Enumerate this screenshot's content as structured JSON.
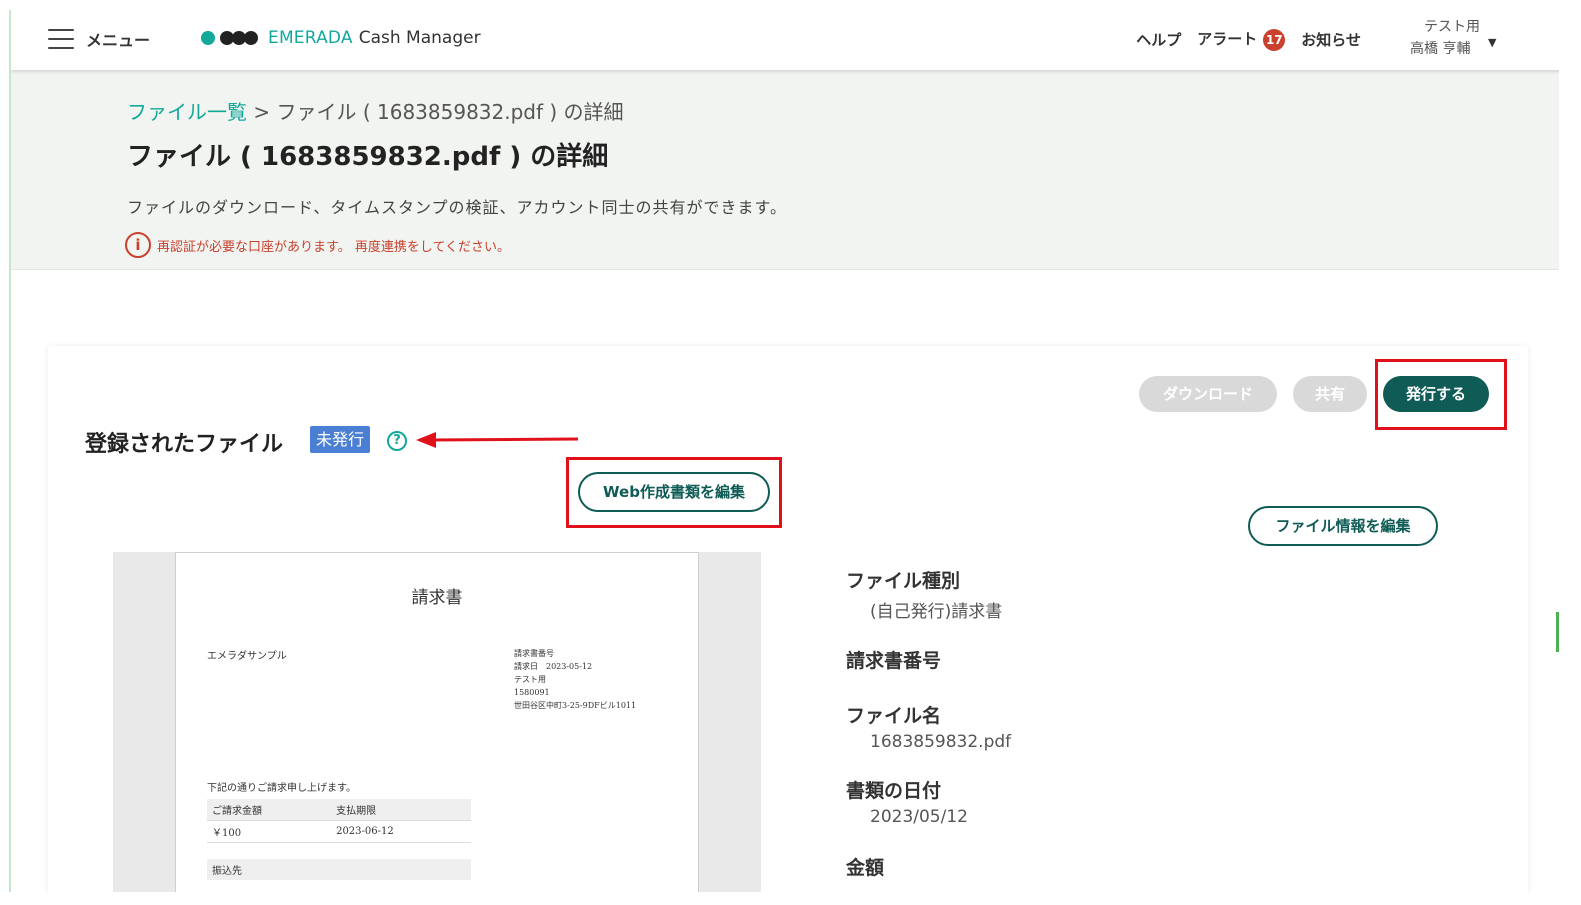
{
  "header": {
    "menu_label": "メニュー",
    "brand_name": "EMERADA",
    "brand_sub": "Cash Manager",
    "nav": {
      "help": "ヘルプ",
      "alert": "アラート",
      "alert_count": "17",
      "notice": "お知らせ"
    },
    "user": {
      "org": "テスト用",
      "name": "高橋 亨輔"
    }
  },
  "title_band": {
    "breadcrumb_link": "ファイル一覧",
    "breadcrumb_sep": " > ",
    "breadcrumb_current": "ファイル ( 1683859832.pdf ) の詳細",
    "page_title": "ファイル ( 1683859832.pdf ) の詳細",
    "description": "ファイルのダウンロード、タイムスタンプの検証、アカウント同士の共有ができます。",
    "warning": "再認証が必要な口座があります。 再度連携をしてください。"
  },
  "actions": {
    "download": "ダウンロード",
    "share": "共有",
    "issue": "発行する"
  },
  "file_section": {
    "title": "登録されたファイル",
    "status": "未発行",
    "help_glyph": "?",
    "web_edit": "Web作成書類を編集",
    "info_edit": "ファイル情報を編集"
  },
  "preview": {
    "title": "請求書",
    "company": "エメラダサンプル",
    "meta_lines": [
      "請求書番号",
      "請求日　2023-05-12",
      "テスト用",
      "1580091",
      "世田谷区中町3-25-9DFビル1011"
    ],
    "intro": "下記の通りご請求申し上げます。",
    "amount_header": "ご請求金額",
    "due_header": "支払期限",
    "amount_value": "￥100",
    "due_value": "2023-06-12",
    "bank_header": "振込先"
  },
  "info": {
    "type_label": "ファイル種別",
    "type_value": "(自己発行)請求書",
    "number_label": "請求書番号",
    "name_label": "ファイル名",
    "name_value": "1683859832.pdf",
    "date_label": "書類の日付",
    "date_value": "2023/05/12",
    "amount_label": "金額"
  },
  "colors": {
    "accent": "#12a99b",
    "primary_dark": "#0f5b55",
    "alert": "#c9412e",
    "status_tag": "#4a7fd4",
    "highlight": "#e0111b"
  }
}
